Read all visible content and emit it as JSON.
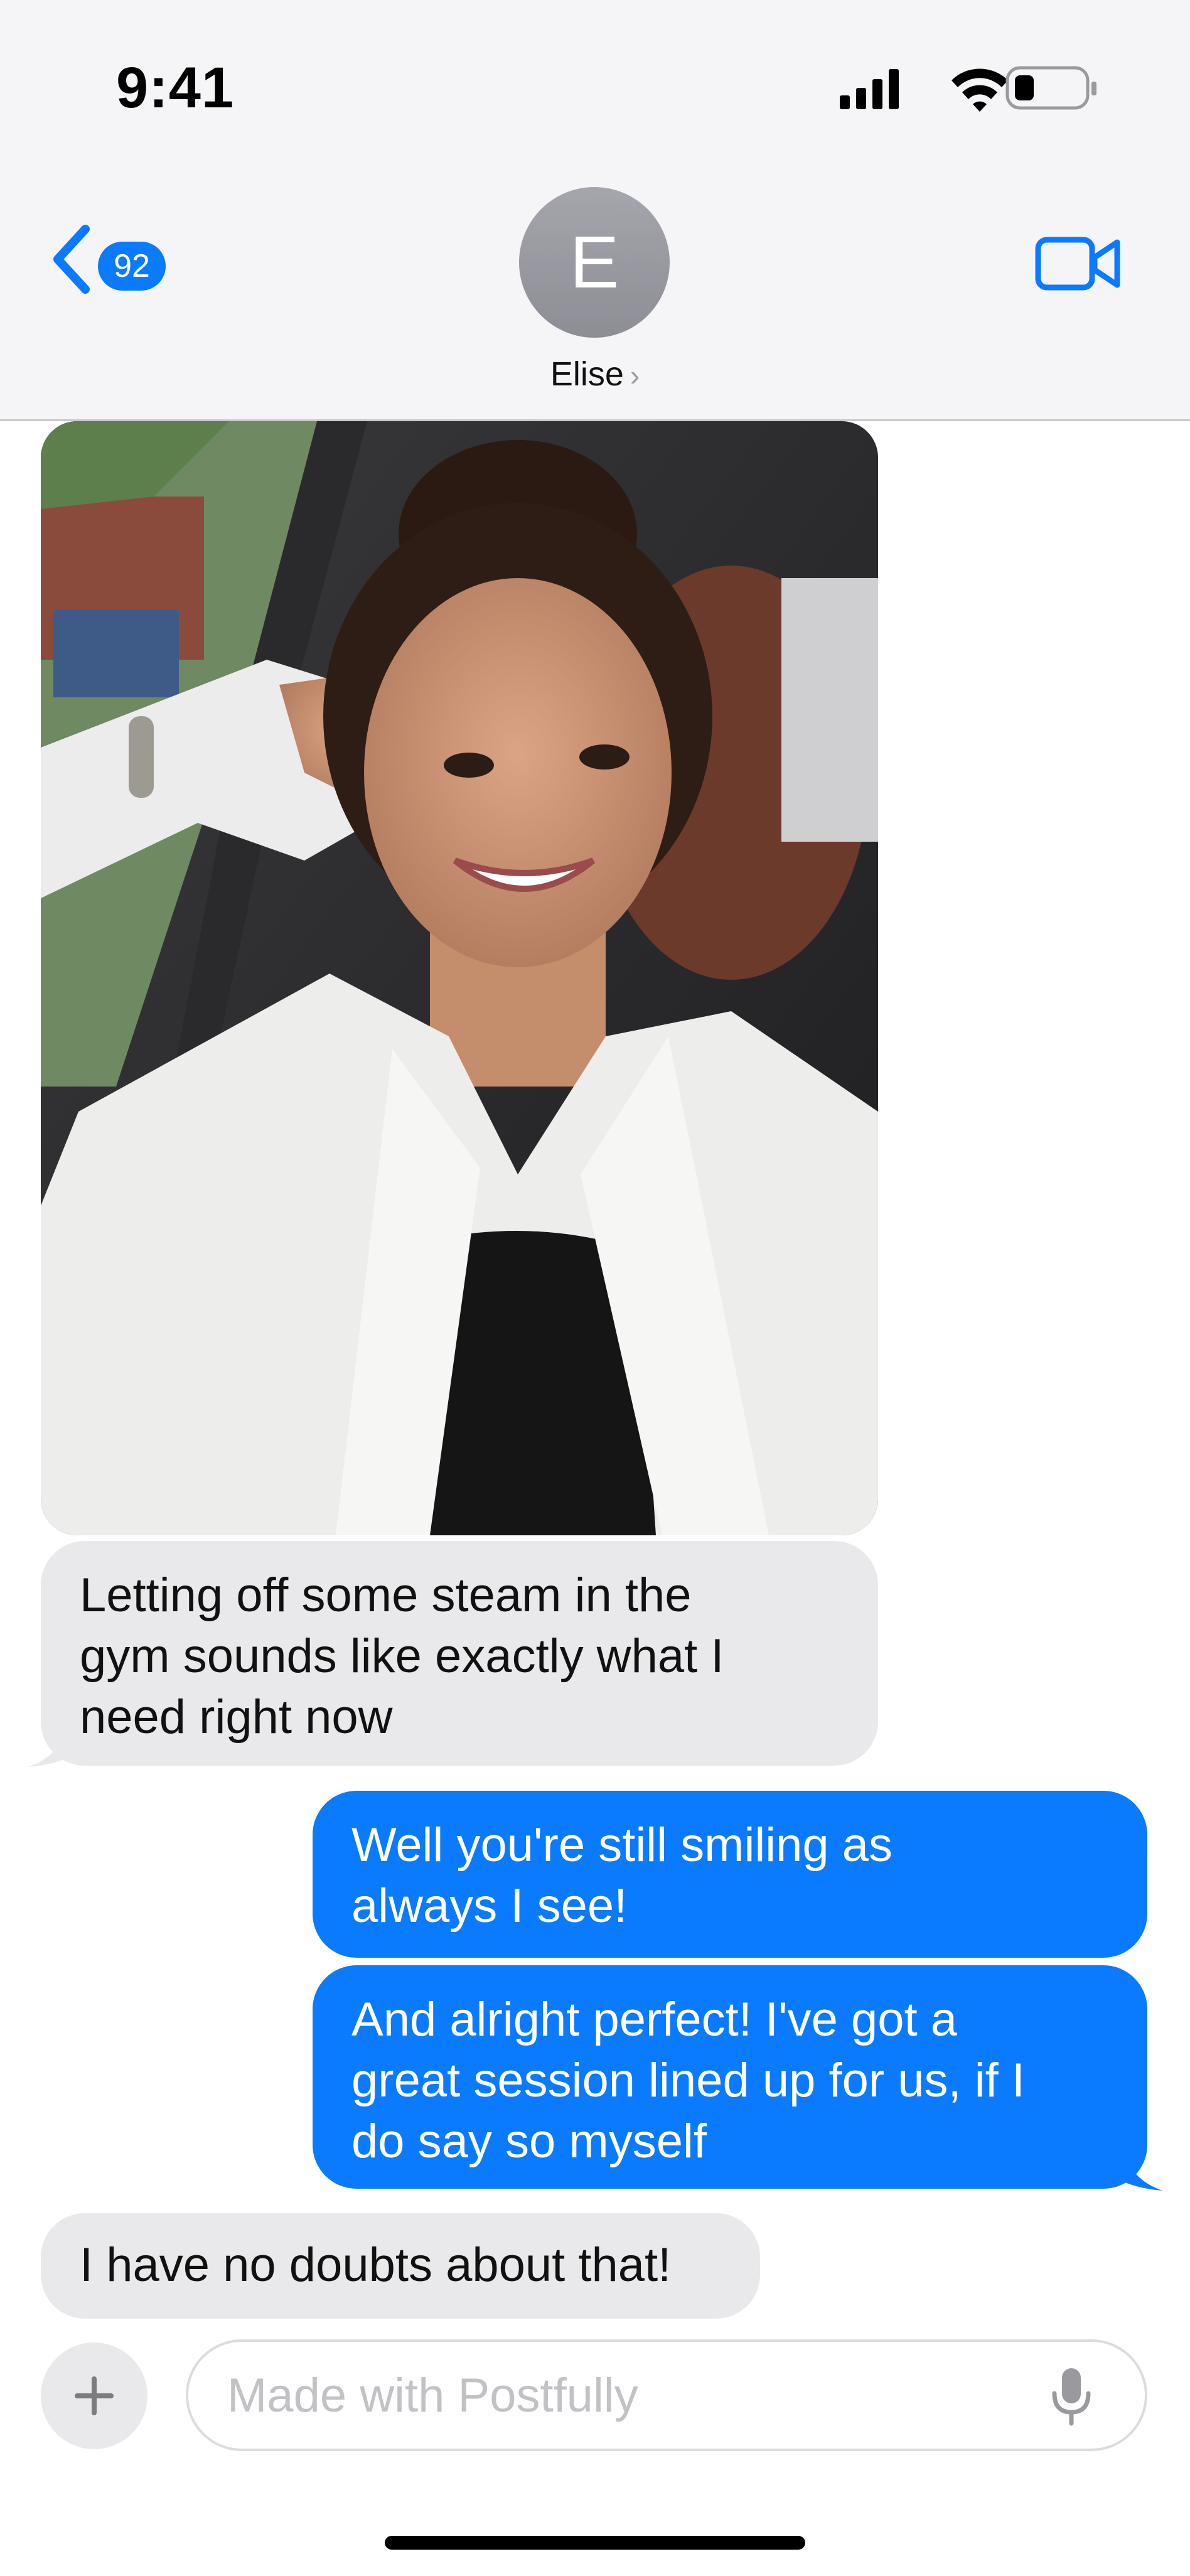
{
  "status_bar": {
    "time": "9:41"
  },
  "header": {
    "back_badge_count": "92",
    "avatar_initial": "E",
    "contact_name": "Elise",
    "contact_chevron": "›",
    "video_icon": "video-camera-icon"
  },
  "messages": [
    {
      "sender": "contact",
      "type": "photo",
      "description_icon": "photo-selfie"
    },
    {
      "sender": "contact",
      "type": "text",
      "lines": [
        "Letting off some steam in the",
        "gym sounds like exactly what I",
        "need right now"
      ]
    },
    {
      "sender": "me",
      "type": "text",
      "lines": [
        "Well you're still smiling as",
        "always I see!"
      ]
    },
    {
      "sender": "me",
      "type": "text",
      "lines": [
        "And alright perfect! I've got a",
        "great session lined up for us, if I",
        "do say so myself"
      ]
    },
    {
      "sender": "contact",
      "type": "text",
      "lines": [
        "I have no doubts about that!"
      ]
    }
  ],
  "composer": {
    "placeholder": "Made with Postfully",
    "plus_icon": "plus-icon",
    "mic_icon": "microphone-icon"
  },
  "colors": {
    "accent": "#0a7aff",
    "incoming_bubble": "#e9e9eb",
    "chrome_bg": "#f5f5f7"
  }
}
